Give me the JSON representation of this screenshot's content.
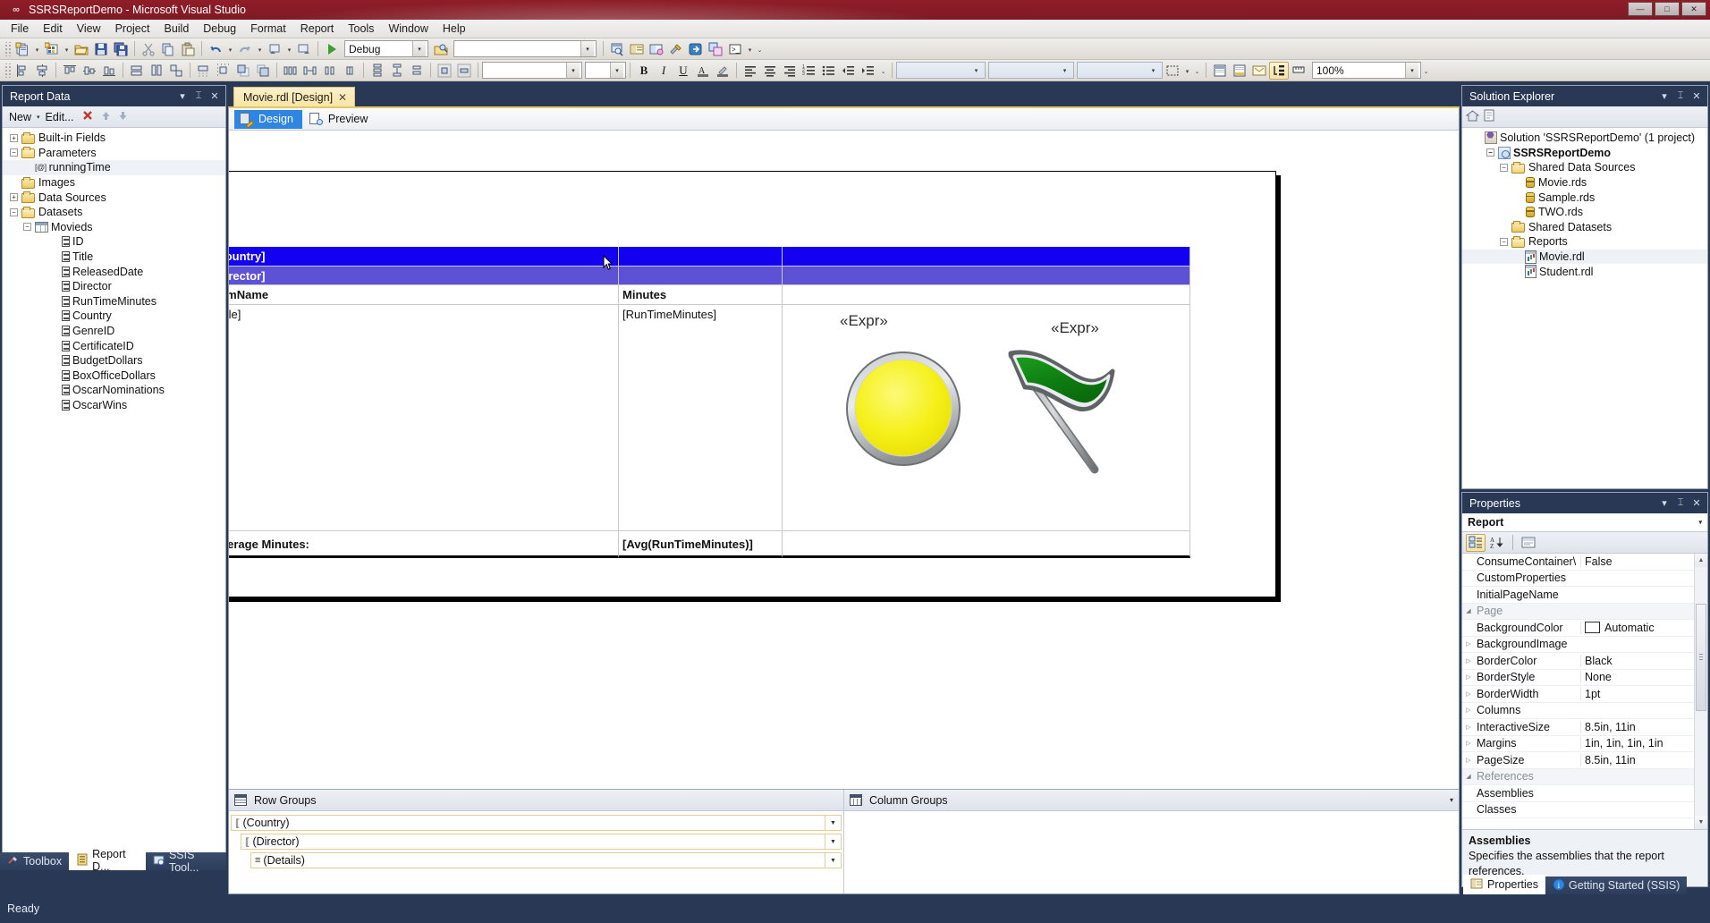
{
  "window": {
    "title": "SSRSReportDemo - Microsoft Visual Studio",
    "minimize": "—",
    "maximize": "□",
    "close": "✕"
  },
  "menu": {
    "items": [
      "File",
      "Edit",
      "View",
      "Project",
      "Build",
      "Debug",
      "Format",
      "Report",
      "Tools",
      "Window",
      "Help"
    ]
  },
  "toolbar": {
    "config_value": "Debug",
    "platform_value": "",
    "zoom_value": "100%",
    "icons": [
      "new-project-icon",
      "new-item-icon",
      "open-file-icon",
      "save-icon",
      "save-all-icon",
      "cut-icon",
      "copy-icon",
      "paste-icon",
      "undo-icon",
      "redo-icon",
      "navigate-backward-icon",
      "navigate-forward-icon",
      "start-debug-icon"
    ]
  },
  "report_data_panel": {
    "title": "Report Data",
    "toolbar": {
      "new_label": "New",
      "edit_label": "Edit...",
      "delete_icon": "delete-x-icon",
      "up_icon": "move-up-icon",
      "down_icon": "move-down-icon"
    },
    "tree": [
      {
        "label": "Built-in Fields",
        "type": "folder",
        "expander": "+",
        "indent": 0
      },
      {
        "label": "Parameters",
        "type": "folder-open",
        "expander": "-",
        "indent": 0
      },
      {
        "label": "runningTime",
        "type": "parameter",
        "param_marker": "[@]",
        "indent": 1,
        "selected": true
      },
      {
        "label": "Images",
        "type": "folder",
        "expander": "",
        "indent": 0
      },
      {
        "label": "Data Sources",
        "type": "folder",
        "expander": "+",
        "indent": 0
      },
      {
        "label": "Datasets",
        "type": "folder-open",
        "expander": "-",
        "indent": 0
      },
      {
        "label": "Movieds",
        "type": "dataset",
        "expander": "-",
        "indent": 1
      },
      {
        "label": "ID",
        "type": "field",
        "indent": 3
      },
      {
        "label": "Title",
        "type": "field",
        "indent": 3
      },
      {
        "label": "ReleasedDate",
        "type": "field",
        "indent": 3
      },
      {
        "label": "Director",
        "type": "field",
        "indent": 3
      },
      {
        "label": "RunTimeMinutes",
        "type": "field",
        "indent": 3
      },
      {
        "label": "Country",
        "type": "field",
        "indent": 3
      },
      {
        "label": "GenreID",
        "type": "field",
        "indent": 3
      },
      {
        "label": "CertificateID",
        "type": "field",
        "indent": 3
      },
      {
        "label": "BudgetDollars",
        "type": "field",
        "indent": 3
      },
      {
        "label": "BoxOfficeDollars",
        "type": "field",
        "indent": 3
      },
      {
        "label": "OscarNominations",
        "type": "field",
        "indent": 3
      },
      {
        "label": "OscarWins",
        "type": "field",
        "indent": 3
      }
    ],
    "bottom_tabs": [
      {
        "label": "Toolbox",
        "active": false,
        "icon": "toolbox-icon"
      },
      {
        "label": "Report D...",
        "active": true,
        "icon": "report-data-icon"
      },
      {
        "label": "SSIS Tool...",
        "active": false,
        "icon": "ssis-toolbox-icon"
      }
    ]
  },
  "document": {
    "tab_label": "Movie.rdl [Design]",
    "close_icon": "close-icon",
    "view_tabs": [
      {
        "label": "Design",
        "active": true,
        "icon": "design-view-icon"
      },
      {
        "label": "Preview",
        "active": false,
        "icon": "preview-view-icon"
      }
    ]
  },
  "report": {
    "rows": {
      "country_header": "[Country]",
      "director_header": "[Director]",
      "col_header_filmname": "FilmName",
      "col_header_minutes": "Minutes",
      "detail_title": "[Title]",
      "detail_minutes": "[RunTimeMinutes]",
      "footer_label": "Average Minutes:",
      "footer_value": "[Avg(RunTimeMinutes)]"
    },
    "indicators": [
      {
        "expr_label": "«Expr»",
        "kind": "gauge-circle-indicator",
        "color": "#f2ed12"
      },
      {
        "expr_label": "«Expr»",
        "kind": "flag-indicator",
        "color": "#118a14"
      }
    ],
    "colors": {
      "country_band": "#1400f0",
      "director_band": "#5d51d6"
    }
  },
  "groups": {
    "row_groups": {
      "title": "Row Groups",
      "icon": "row-groups-icon",
      "items": [
        {
          "label": "(Country)",
          "indent": 0,
          "marker": "⟦"
        },
        {
          "label": "(Director)",
          "indent": 1,
          "marker": "⟦"
        },
        {
          "label": "(Details)",
          "indent": 2,
          "marker": "≡"
        }
      ]
    },
    "column_groups": {
      "title": "Column Groups",
      "icon": "column-groups-icon",
      "items": []
    }
  },
  "solution_explorer": {
    "title": "Solution Explorer",
    "toolbar_icons": [
      "home-icon",
      "properties-page-icon"
    ],
    "tree": [
      {
        "label": "Solution 'SSRSReportDemo' (1 project)",
        "type": "solution",
        "indent": 0
      },
      {
        "label": "SSRSReportDemo",
        "type": "project",
        "indent": 1,
        "bold": true,
        "expander": "-"
      },
      {
        "label": "Shared Data Sources",
        "type": "folder-open",
        "indent": 2,
        "expander": "-"
      },
      {
        "label": "Movie.rds",
        "type": "rds",
        "indent": 3
      },
      {
        "label": "Sample.rds",
        "type": "rds",
        "indent": 3
      },
      {
        "label": "TWO.rds",
        "type": "rds",
        "indent": 3
      },
      {
        "label": "Shared Datasets",
        "type": "folder",
        "indent": 2
      },
      {
        "label": "Reports",
        "type": "folder-open",
        "indent": 2,
        "expander": "-"
      },
      {
        "label": "Movie.rdl",
        "type": "rdl",
        "indent": 3,
        "selected": true
      },
      {
        "label": "Student.rdl",
        "type": "rdl",
        "indent": 3
      }
    ]
  },
  "properties_panel": {
    "title": "Properties",
    "selected_object": "Report",
    "toolbar_icons": [
      "categorized-icon",
      "alphabetical-icon",
      "property-pages-icon"
    ],
    "rows": [
      {
        "name": "ConsumeContainer\\",
        "value": "False",
        "expandable": false
      },
      {
        "name": "CustomProperties",
        "value": "",
        "expandable": false
      },
      {
        "name": "InitialPageName",
        "value": "",
        "expandable": false
      },
      {
        "name": "Page",
        "value": "",
        "category": true
      },
      {
        "name": "BackgroundColor",
        "value": "Automatic",
        "swatch": "#ffffff",
        "expandable": false
      },
      {
        "name": "BackgroundImage",
        "value": "",
        "expandable": true
      },
      {
        "name": "BorderColor",
        "value": "Black",
        "expandable": true
      },
      {
        "name": "BorderStyle",
        "value": "None",
        "expandable": true
      },
      {
        "name": "BorderWidth",
        "value": "1pt",
        "expandable": true
      },
      {
        "name": "Columns",
        "value": "",
        "expandable": true
      },
      {
        "name": "InteractiveSize",
        "value": "8.5in, 11in",
        "expandable": true
      },
      {
        "name": "Margins",
        "value": "1in, 1in, 1in, 1in",
        "expandable": true
      },
      {
        "name": "PageSize",
        "value": "8.5in, 11in",
        "expandable": true
      },
      {
        "name": "References",
        "value": "",
        "category": true
      },
      {
        "name": "Assemblies",
        "value": "",
        "expandable": false
      },
      {
        "name": "Classes",
        "value": "",
        "expandable": false
      }
    ],
    "description": {
      "title": "Assemblies",
      "text": "Specifies the assemblies that the report references."
    },
    "bottom_tabs": [
      {
        "label": "Properties",
        "active": true,
        "icon": "properties-icon"
      },
      {
        "label": "Getting Started (SSIS)",
        "active": false,
        "icon": "info-icon"
      }
    ]
  },
  "status_bar": {
    "text": "Ready"
  }
}
